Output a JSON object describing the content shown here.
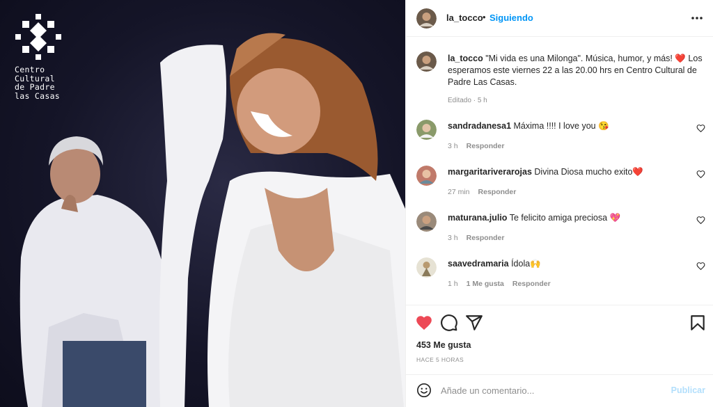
{
  "photo": {
    "logo_text": "Centro\nCultural\nde Padre\nlas Casas"
  },
  "post": {
    "header": {
      "username": "la_tocco",
      "separator": "•",
      "follow_label": "Siguiendo"
    },
    "caption": {
      "username": "la_tocco",
      "text": "\"Mi vida es una Milonga\". Música, humor, y más! ❤️ Los esperamos este viernes 22 a las 20.00 hrs en Centro Cultural de Padre Las Casas.",
      "edited": "Editado",
      "time": "5 h"
    },
    "comments": [
      {
        "username": "sandradanesa1",
        "text": "Máxima !!!! I love you 😘",
        "time": "3 h",
        "likes": "",
        "reply": "Responder"
      },
      {
        "username": "margaritariverarojas",
        "text": "Divina Diosa mucho exito❤️",
        "time": "27 min",
        "likes": "",
        "reply": "Responder"
      },
      {
        "username": "maturana.julio",
        "text": "Te felicito amiga preciosa 💖",
        "time": "3 h",
        "likes": "",
        "reply": "Responder"
      },
      {
        "username": "saavedramaria",
        "text": "Ídola🙌",
        "time": "1 h",
        "likes": "1 Me gusta",
        "reply": "Responder"
      }
    ],
    "likes_count": "453 Me gusta",
    "time_ago": "HACE 5 HORAS",
    "add_comment": {
      "placeholder": "Añade un comentario...",
      "publish_label": "Publicar"
    }
  },
  "icons": {
    "like": "heart-filled-icon",
    "comment": "comment-icon",
    "share": "paper-plane-icon",
    "save": "bookmark-icon",
    "more": "more-horizontal-icon",
    "emoji": "emoji-icon"
  },
  "colors": {
    "accent": "#0095f6",
    "like_red": "#ed4956",
    "muted": "#8e8e8e",
    "publish_disabled": "#b2dffc"
  }
}
